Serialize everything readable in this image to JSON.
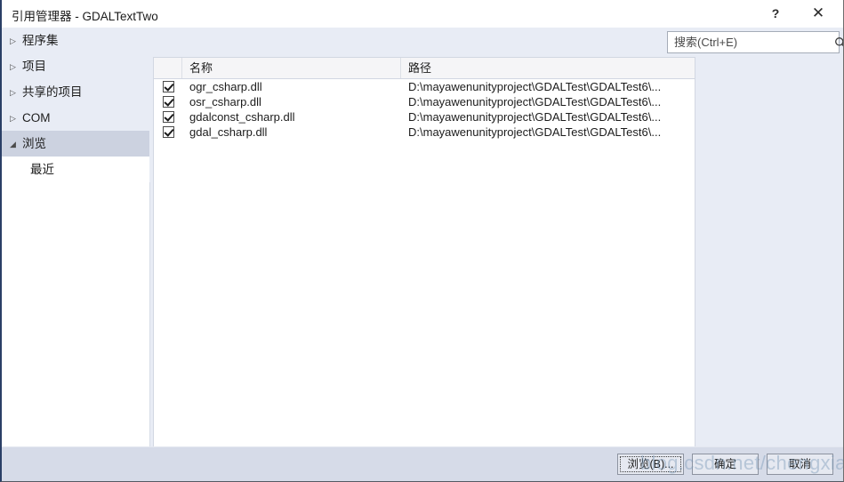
{
  "window": {
    "title": "引用管理器 - GDALTextTwo",
    "help_label": "?",
    "close_label": "✕"
  },
  "sidebar": {
    "items": [
      {
        "label": "程序集",
        "arrow": "▷",
        "expanded": false,
        "selected": false
      },
      {
        "label": "项目",
        "arrow": "▷",
        "expanded": false,
        "selected": false
      },
      {
        "label": "共享的项目",
        "arrow": "▷",
        "expanded": false,
        "selected": false
      },
      {
        "label": "COM",
        "arrow": "▷",
        "expanded": false,
        "selected": false
      },
      {
        "label": "浏览",
        "arrow": "◢",
        "expanded": true,
        "selected": true
      }
    ],
    "sub_items": [
      {
        "label": "最近"
      }
    ]
  },
  "search": {
    "placeholder": "搜索(Ctrl+E)",
    "value": "",
    "icon": "search-icon",
    "dropdown_icon": "chevron-down-icon"
  },
  "list": {
    "columns": [
      {
        "key": "check",
        "label": ""
      },
      {
        "key": "name",
        "label": "名称"
      },
      {
        "key": "path",
        "label": "路径"
      }
    ],
    "rows": [
      {
        "checked": true,
        "name": "ogr_csharp.dll",
        "path": "D:\\mayawenunityproject\\GDALTest\\GDALTest6\\..."
      },
      {
        "checked": true,
        "name": "osr_csharp.dll",
        "path": "D:\\mayawenunityproject\\GDALTest\\GDALTest6\\..."
      },
      {
        "checked": true,
        "name": "gdalconst_csharp.dll",
        "path": "D:\\mayawenunityproject\\GDALTest\\GDALTest6\\..."
      },
      {
        "checked": true,
        "name": "gdal_csharp.dll",
        "path": "D:\\mayawenunityproject\\GDALTest\\GDALTest6\\..."
      }
    ]
  },
  "footer": {
    "browse_label": "浏览(B)...",
    "ok_label": "确定",
    "cancel_label": "取消"
  },
  "watermark": {
    "text": "blog.csdn.net/chengxiaola"
  },
  "colors": {
    "dialog_background": "#e8ecf5",
    "titlebar_background": "#ffffff",
    "selection": "#ccd2e0",
    "footer_background": "#d6dbe8",
    "panel_background": "#ffffff",
    "accent_border": "#2a3f66"
  }
}
